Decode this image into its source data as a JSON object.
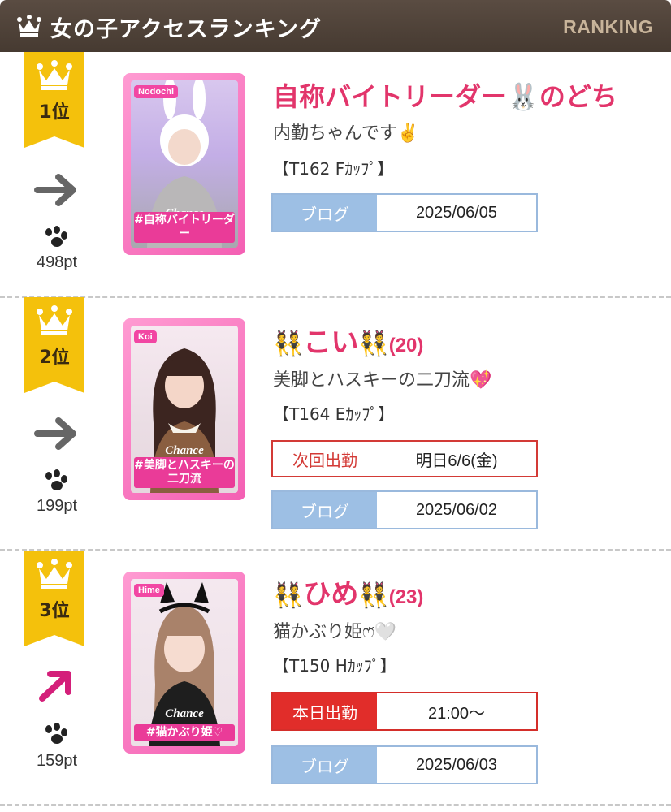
{
  "header": {
    "title": "女の子アクセスランキング",
    "tag": "RANKING",
    "icon": "crown-icon"
  },
  "colors": {
    "header_bg": "#4f4239",
    "badge": "#f4c10c",
    "name": "#e2356b",
    "blog_label_bg": "#9dbfe4",
    "next_border": "#d33a36",
    "today_bg": "#e12d2a",
    "photo_frame": "#f45fb3"
  },
  "ranking": [
    {
      "rank": "1位",
      "trend": "arrow-right-icon",
      "trend_color": "#666666",
      "points": "498pt",
      "photo": {
        "name_tag": "Nodochi",
        "brand": "Chance",
        "caption": "#自称バイトリーダー"
      },
      "name": "自称バイトリーダー🐰のどち",
      "catch": "内勤ちゃんです✌️",
      "spec": "【T162 Fｶｯﾌﾟ】",
      "blog_label": "ブログ",
      "blog_date": "2025/06/05"
    },
    {
      "rank": "2位",
      "trend": "arrow-right-icon",
      "trend_color": "#666666",
      "points": "199pt",
      "photo": {
        "name_tag": "Koi",
        "brand": "Chance",
        "caption": "#美脚とハスキーの二刀流"
      },
      "name_prefix": "👯",
      "name": "こい",
      "name_suffix": "👯",
      "age": "(20)",
      "catch": "美脚とハスキーの二刀流💖",
      "spec": "【T164 Eｶｯﾌﾟ】",
      "schedule_label": "次回出勤",
      "schedule_value": "明日6/6(金)",
      "blog_label": "ブログ",
      "blog_date": "2025/06/02"
    },
    {
      "rank": "3位",
      "trend": "arrow-up-right-icon",
      "trend_color": "#d41f7a",
      "points": "159pt",
      "photo": {
        "name_tag": "Hime",
        "brand": "Chance",
        "caption": "#猫かぶり姫♡"
      },
      "name_prefix": "👯",
      "name": "ひめ",
      "name_suffix": "👯",
      "age": "(23)",
      "catch": "猫かぶり姫ෆ̈🤍",
      "spec": "【T150 Hｶｯﾌﾟ】",
      "schedule_label": "本日出勤",
      "schedule_value": "21:00〜",
      "blog_label": "ブログ",
      "blog_date": "2025/06/03"
    }
  ]
}
